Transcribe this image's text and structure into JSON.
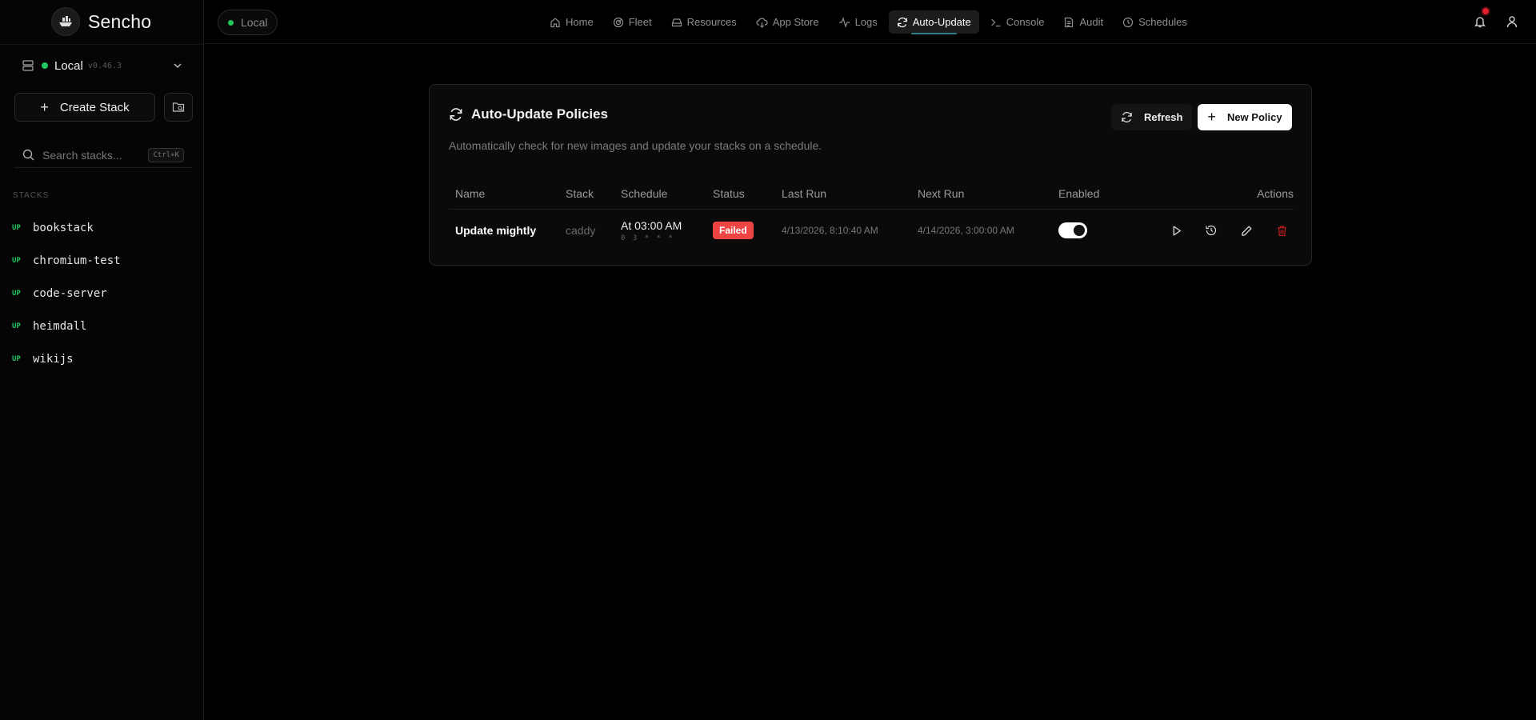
{
  "app": {
    "name": "Sencho"
  },
  "topbar": {
    "env_label": "Local",
    "nav": [
      {
        "label": "Home",
        "icon": "home-icon"
      },
      {
        "label": "Fleet",
        "icon": "radar-icon"
      },
      {
        "label": "Resources",
        "icon": "hard-drive-icon"
      },
      {
        "label": "App Store",
        "icon": "cloud-download-icon"
      },
      {
        "label": "Logs",
        "icon": "activity-icon"
      },
      {
        "label": "Auto-Update",
        "icon": "refresh-icon",
        "active": true
      },
      {
        "label": "Console",
        "icon": "terminal-icon"
      },
      {
        "label": "Audit",
        "icon": "file-text-icon"
      },
      {
        "label": "Schedules",
        "icon": "clock-icon"
      }
    ]
  },
  "sidebar": {
    "node": {
      "name": "Local",
      "version": "v0.46.3"
    },
    "create_stack_label": "Create Stack",
    "search": {
      "placeholder": "Search stacks...",
      "shortcut": "Ctrl+K"
    },
    "stacks_header": "STACKS",
    "stacks": [
      {
        "status": "UP",
        "name": "bookstack"
      },
      {
        "status": "UP",
        "name": "chromium-test"
      },
      {
        "status": "UP",
        "name": "code-server"
      },
      {
        "status": "UP",
        "name": "heimdall"
      },
      {
        "status": "UP",
        "name": "wikijs"
      }
    ]
  },
  "panel": {
    "title": "Auto-Update Policies",
    "subtitle": "Automatically check for new images and update your stacks on a schedule.",
    "refresh_label": "Refresh",
    "new_policy_label": "New Policy",
    "columns": [
      "Name",
      "Stack",
      "Schedule",
      "Status",
      "Last Run",
      "Next Run",
      "Enabled",
      "Actions"
    ],
    "rows": [
      {
        "name": "Update mightly",
        "stack": "caddy",
        "schedule": "At 03:00 AM",
        "cron": "0 3 * * *",
        "status": "Failed",
        "last_run": "4/13/2026, 8:10:40 AM",
        "next_run": "4/14/2026, 3:00:00 AM",
        "enabled": true
      }
    ]
  },
  "colors": {
    "accent_green": "#22c55e",
    "status_failed": "#ef4444",
    "delete_red": "#b91c1c",
    "notification": "#e11d2a"
  }
}
